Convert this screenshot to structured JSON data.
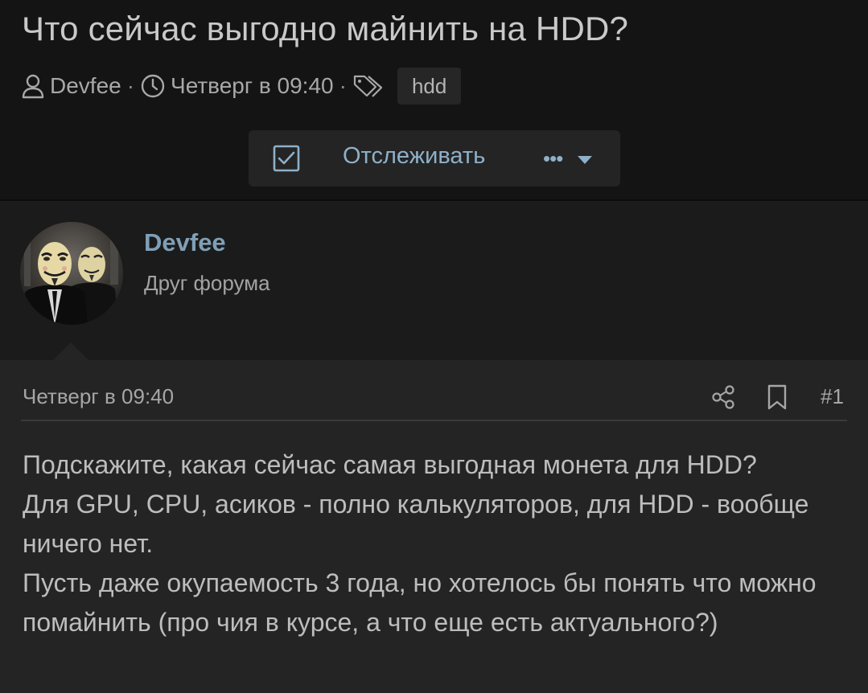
{
  "thread": {
    "title": "Что сейчас выгодно майнить на HDD?",
    "author": "Devfee",
    "date": "Четверг в 09:40",
    "separator": "·",
    "tags": [
      "hdd"
    ]
  },
  "actions": {
    "watch_label": "Отслеживать",
    "more_label": "•••"
  },
  "post": {
    "username": "Devfee",
    "user_title": "Друг форума",
    "date": "Четверг в 09:40",
    "number": "#1",
    "body_lines": [
      "Подскажите, какая сейчас самая выгодная монета для HDD?",
      "Для GPU, CPU, асиков - полно калькуляторов, для HDD - вообще ничего нет.",
      "Пусть даже окупаемость 3 года, но хотелось бы понять что можно помайнить (про чия в курсе, а что еще есть актуального?)"
    ]
  },
  "icons": {
    "author": "user-icon",
    "date": "clock-icon",
    "tags": "tag-icon",
    "watch": "checkbox-icon",
    "more_caret": "caret-down-icon",
    "share": "share-icon",
    "bookmark": "bookmark-icon"
  },
  "colors": {
    "background": "#141414",
    "user_block": "#1b1b1b",
    "post_background": "#242424",
    "accent": "#7f9fb7",
    "link": "#8fb0c8",
    "text": "#bdbdbd"
  }
}
